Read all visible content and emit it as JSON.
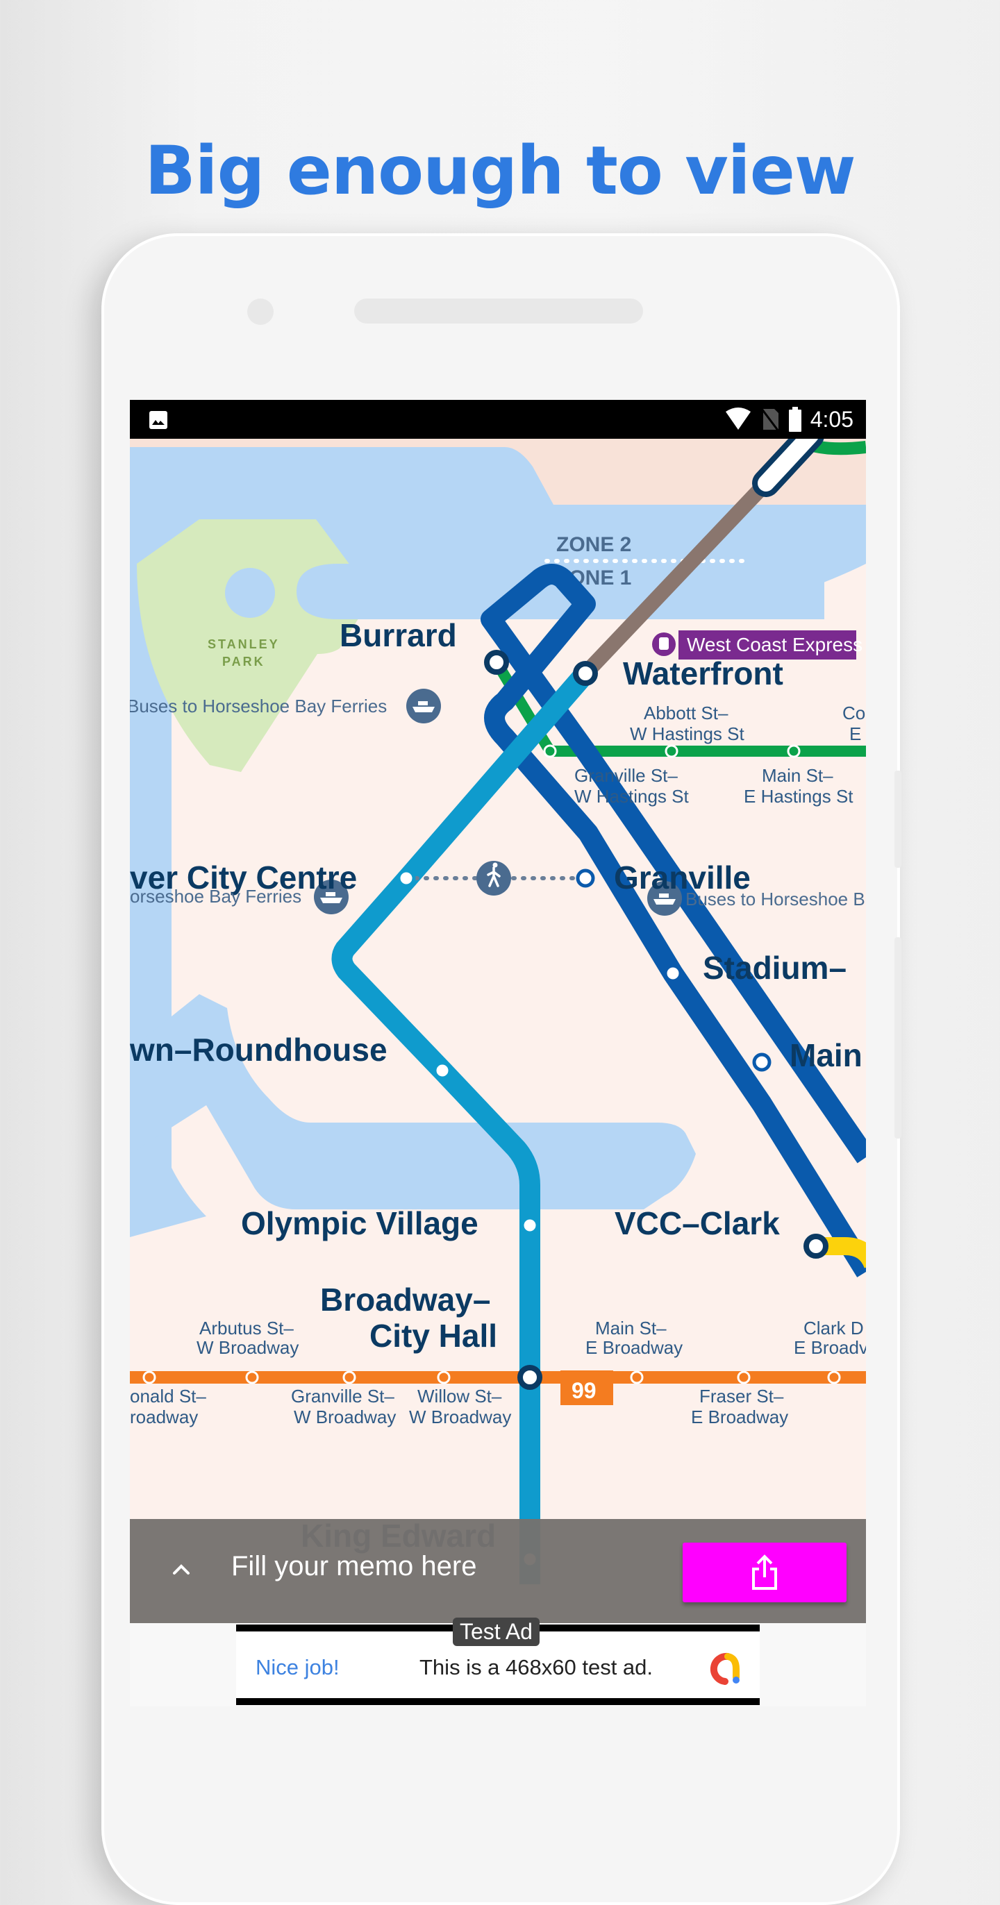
{
  "headline": "Big enough to view",
  "status_bar": {
    "left_icon": "image-icon",
    "icons": [
      "wifi-icon",
      "no-sim-icon",
      "battery-icon"
    ],
    "time": "4:05"
  },
  "map": {
    "zones": {
      "upper": "ZONE 2",
      "lower": "ZONE 1"
    },
    "park_label": [
      "STANLEY",
      "PARK"
    ],
    "west_coast_express": "West Coast Express",
    "major_stations": {
      "burrard": "Burrard",
      "waterfront": "Waterfront",
      "vancouver_city_centre": "ver City Centre",
      "granville": "Granville",
      "stadium": "Stadium–",
      "main": "Main",
      "yaletown": "wn–Roundhouse",
      "olympic_village": "Olympic Village",
      "vcc_clark": "VCC–Clark",
      "broadway_city_hall_1": "Broadway–",
      "broadway_city_hall_2": "City Hall",
      "king_edward": "King Edward"
    },
    "ferry_labels": {
      "burrard": "Buses to Horseshoe Bay Ferries",
      "city_centre": "orseshoe Bay Ferries",
      "granville": "Buses to Horseshoe B"
    },
    "hastings_stops": {
      "abbott_1": "Abbott St–",
      "abbott_2": "W Hastings St",
      "granville_1": "Granville St–",
      "granville_2": "W Hastings St",
      "main_1": "Main St–",
      "main_2": "E Hastings St",
      "cordova_1": "Co",
      "cordova_2": "E"
    },
    "broadway_stops": {
      "arbutus_1": "Arbutus St–",
      "arbutus_2": "W Broadway",
      "macdonald_1": "onald St–",
      "macdonald_2": "roadway",
      "granville_1": "Granville St–",
      "granville_2": "W Broadway",
      "willow_1": "Willow St–",
      "willow_2": "W Broadway",
      "main_1": "Main St–",
      "main_2": "E Broadway",
      "fraser_1": "Fraser St–",
      "fraser_2": "E Broadway",
      "clark_1": "Clark D",
      "clark_2": "E Broadv"
    },
    "bus_route": "99",
    "colors": {
      "water": "#b5d6f5",
      "land": "#fdf1ec",
      "land_north": "#f8e2d8",
      "park": "#d6eabd",
      "expo_line": "#0a5aac",
      "canada_line": "#0f9bcd",
      "wce_line": "#8a766e",
      "hastings_bus": "#0ba24a",
      "broadway_bus": "#f47c20",
      "millennium_line": "#fcd20c",
      "wce_badge": "#7a2a8f",
      "station_text": "#0b3a63"
    }
  },
  "memo_bar": {
    "placeholder": "Fill your memo here",
    "expand_icon": "chevron-up-icon",
    "share_icon": "share-icon",
    "share_color": "#ff00ff"
  },
  "ad": {
    "label": "Test Ad",
    "headline": "Nice job!",
    "body": "This is a 468x60 test ad."
  }
}
